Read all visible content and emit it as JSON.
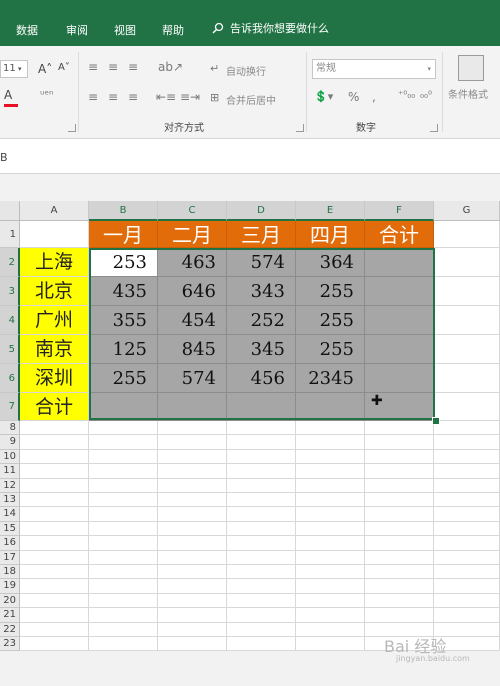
{
  "ribbon_tabs": [
    "数据",
    "审阅",
    "视图",
    "帮助"
  ],
  "tell_me": "告诉我你想要做什么",
  "font_size": "11",
  "wrap_text_label": "自动换行",
  "merge_center_label": "合并后居中",
  "number_format": "常规",
  "conditional_format_label": "条件格式",
  "group_alignment": "对齐方式",
  "group_number": "数字",
  "name_box": "B",
  "column_headers": [
    "A",
    "B",
    "C",
    "D",
    "E",
    "F",
    "G"
  ],
  "row_headers": [
    "1",
    "2",
    "3",
    "4",
    "5",
    "6",
    "7",
    "8",
    "9",
    "10",
    "11",
    "12",
    "13",
    "14",
    "15",
    "16",
    "17",
    "18",
    "19",
    "20",
    "21",
    "22",
    "23"
  ],
  "table": {
    "months": [
      "一月",
      "二月",
      "三月",
      "四月"
    ],
    "total_header": "合计",
    "rows": [
      {
        "city": "上海",
        "values": [
          "253",
          "463",
          "574",
          "364"
        ]
      },
      {
        "city": "北京",
        "values": [
          "435",
          "646",
          "343",
          "255"
        ]
      },
      {
        "city": "广州",
        "values": [
          "355",
          "454",
          "252",
          "255"
        ]
      },
      {
        "city": "南京",
        "values": [
          "125",
          "845",
          "345",
          "255"
        ]
      },
      {
        "city": "深圳",
        "values": [
          "255",
          "574",
          "456",
          "2345"
        ]
      }
    ],
    "total_row_label": "合计"
  },
  "colors": {
    "ribbon_green": "#217346",
    "header_orange": "#e36c0a",
    "city_yellow": "#ffff00",
    "selection_gray": "#a6a6a6"
  },
  "watermark": "Bai 经验",
  "watermark_sub": "jingyan.baidu.com"
}
